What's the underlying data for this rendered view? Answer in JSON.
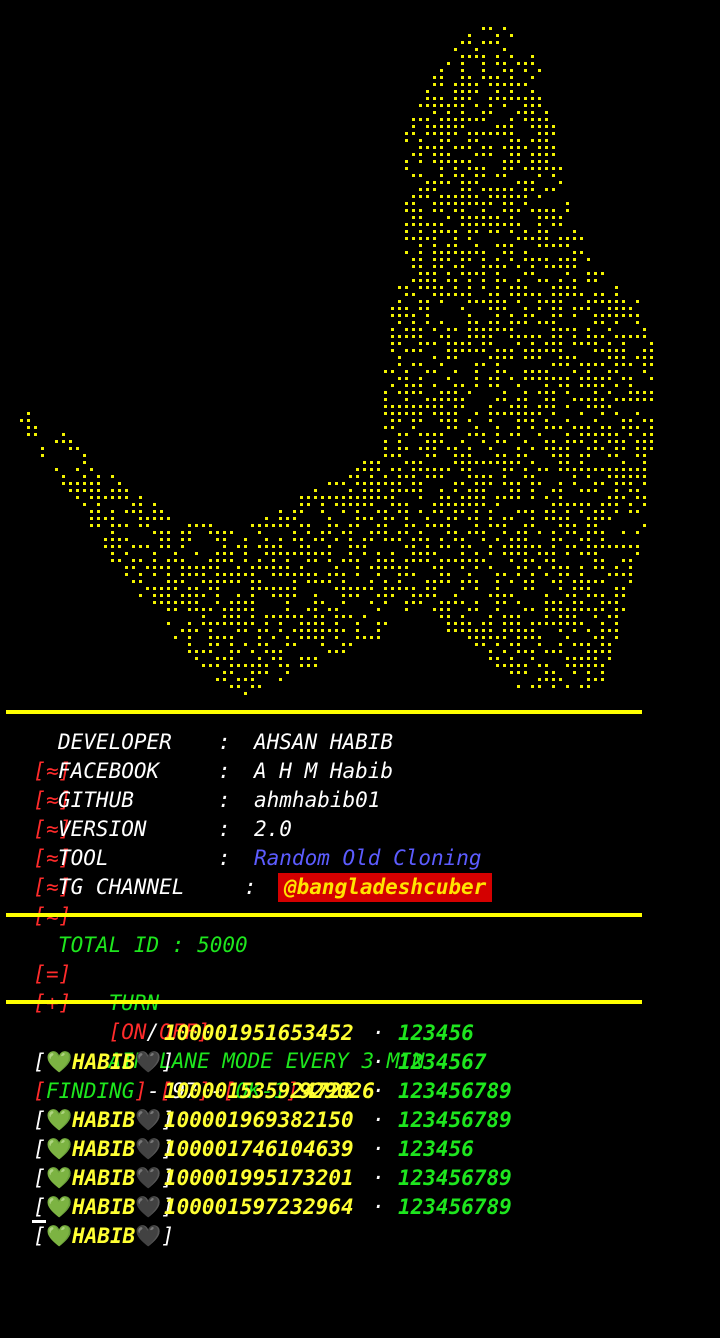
{
  "info": [
    {
      "bracket": "[≈]",
      "label": "DEVELOPER",
      "value": "AHSAN HABIB"
    },
    {
      "bracket": "[≈]",
      "label": "FACEBOOK",
      "value": "A H M Habib"
    },
    {
      "bracket": "[≈]",
      "label": "GITHUB",
      "value": "ahmhabib01"
    },
    {
      "bracket": "[≈]",
      "label": "VERSION",
      "value": "2.0"
    },
    {
      "bracket": "[≈]",
      "label": "TOOL",
      "value": "Random Old Cloning"
    },
    {
      "bracket": "[≈]",
      "label": "TG CHANNEL",
      "value": "@bangladeshcuber"
    }
  ],
  "status": {
    "total_bracket": "[=]",
    "total_text": "TOTAL ID : 5000",
    "turn_bracket": "[+]",
    "turn_prefix": "TURN",
    "turn_on": "ON",
    "turn_off": "OFF",
    "turn_suffix": "AIRPLANE MODE EVERY 3 MIN"
  },
  "log_rows": [
    {
      "tag": "HABIB",
      "uid": "100001951653452",
      "pass": "123456"
    },
    {
      "finding": "FINDING",
      "count": "97",
      "ok": "OK-1",
      "uid": "929026",
      "pass": "1234567"
    },
    {
      "tag": "HABIB",
      "uid": "100001535924723",
      "pass": "123456789"
    },
    {
      "tag": "HABIB",
      "uid": "100001969382150",
      "pass": "123456789"
    },
    {
      "tag": "HABIB",
      "uid": "100001746104639",
      "pass": "123456"
    },
    {
      "tag": "HABIB",
      "uid": "100001995173201",
      "pass": "123456789"
    },
    {
      "tag": "HABIB",
      "uid": "100001597232964",
      "pass": "123456789"
    }
  ],
  "colors": {
    "accent": "#ffff00",
    "label": "#ffffff",
    "bracket": "#ff2b2b",
    "success": "#1ee61e",
    "tool": "#5c5cff",
    "tg_bg": "#d40000",
    "tg_fg": "#ffe400"
  },
  "icons": [
    "green-heart-icon",
    "black-heart-icon"
  ]
}
